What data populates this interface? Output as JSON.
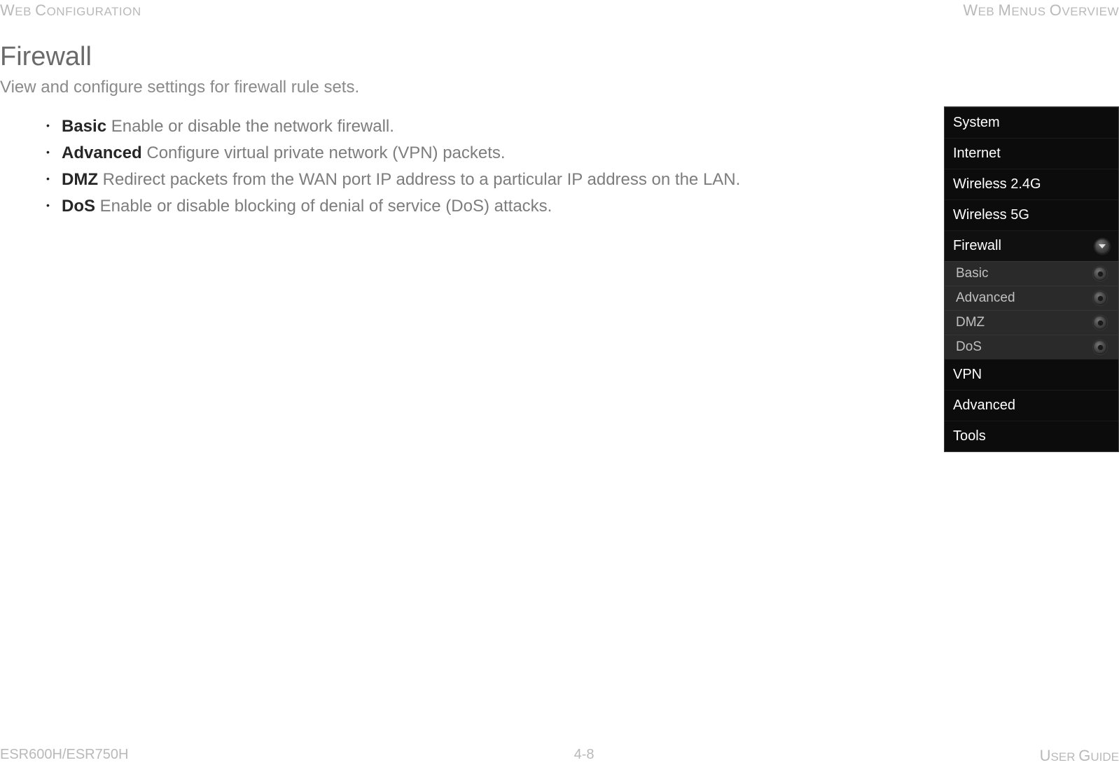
{
  "header": {
    "left": "Web Configuration",
    "right": "Web Menus Overview"
  },
  "page": {
    "title": "Firewall",
    "subtitle": "View and configure settings for firewall rule sets.",
    "items": [
      {
        "term": "Basic",
        "desc": "  Enable or disable the network firewall."
      },
      {
        "term": "Advanced",
        "desc": "  Configure virtual private network (VPN) packets."
      },
      {
        "term": "DMZ",
        "desc": "  Redirect packets from the WAN port IP address to a particular IP address on the LAN."
      },
      {
        "term": "DoS",
        "desc": "  Enable or disable blocking of denial of service (DoS) attacks."
      }
    ]
  },
  "nav": {
    "top": [
      "System",
      "Internet",
      "Wireless 2.4G",
      "Wireless 5G"
    ],
    "active": "Firewall",
    "sub": [
      "Basic",
      "Advanced",
      "DMZ",
      "DoS"
    ],
    "bottom": [
      "VPN",
      "Advanced",
      "Tools"
    ]
  },
  "footer": {
    "left": "ESR600H/ESR750H",
    "center": "4-8",
    "right": "User Guide"
  }
}
